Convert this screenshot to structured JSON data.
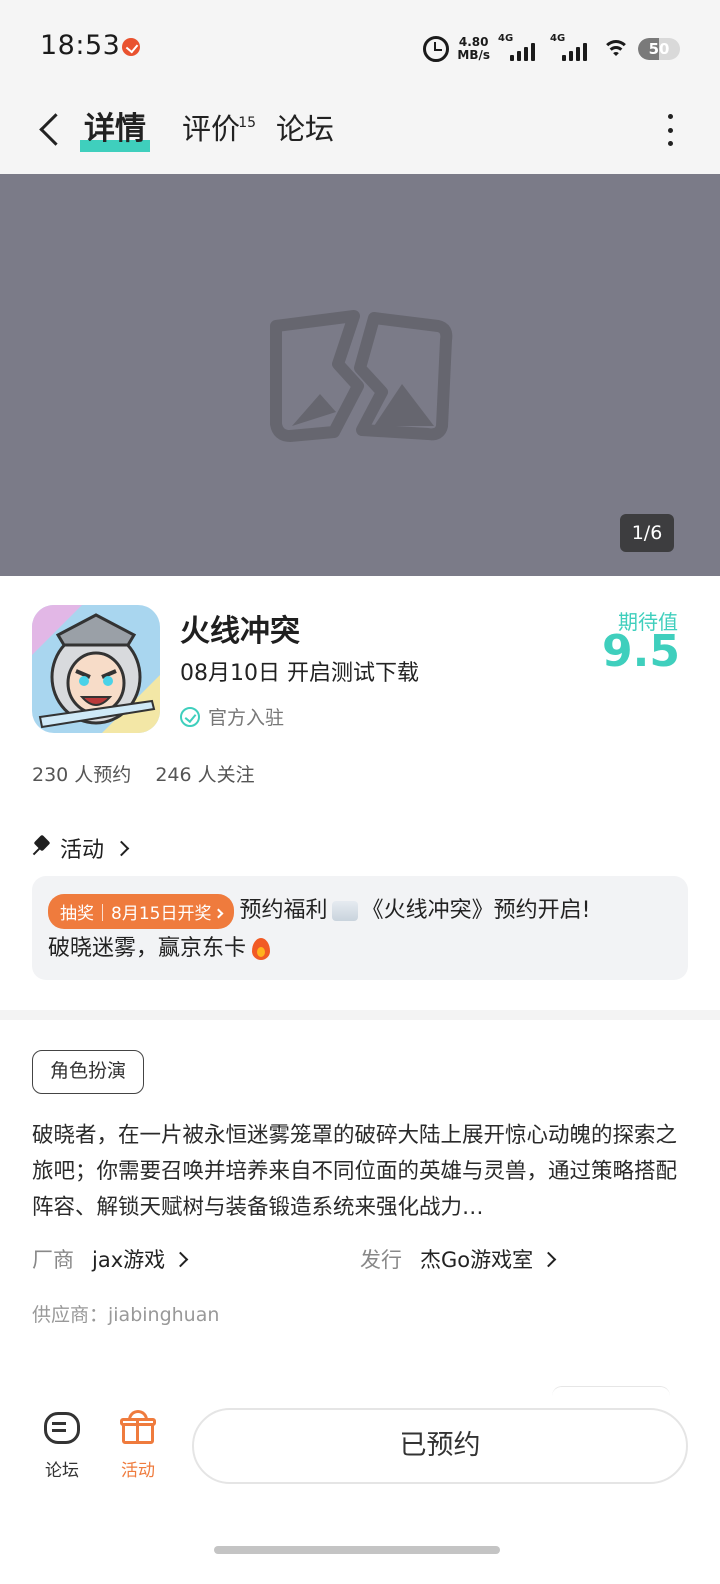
{
  "status_bar": {
    "time": "18:53",
    "net_speed_value": "4.80",
    "net_speed_unit": "MB/s",
    "signal1_label": "4G",
    "signal2_label": "4G",
    "battery": "50",
    "battery_level": 0.5
  },
  "header": {
    "tabs": [
      {
        "label": "详情",
        "active": true
      },
      {
        "label": "评价",
        "badge": "15"
      },
      {
        "label": "论坛"
      }
    ]
  },
  "banner": {
    "page_indicator": "1/6"
  },
  "game": {
    "title": "火线冲突",
    "date_text": "08月10日 开启测试下载",
    "official_label": "官方入驻",
    "expect_label": "期待值",
    "expect_score": "9.5",
    "reservations": "230 人预约",
    "followers": "246 人关注"
  },
  "activity": {
    "heading": "活动",
    "tag": "抽奖｜8月15日开奖",
    "text_part1": "预约福利",
    "text_part2": "《火线冲突》预约开启!",
    "text_part3": "破晓迷雾，赢京东卡"
  },
  "details": {
    "genre": "角色扮演",
    "description": "破晓者，在一片被永恒迷雾笼罩的破碎大陆上展开惊心动魄的探索之旅吧；你需要召唤并培养来自不同位面的英雄与灵兽，通过策略搭配阵容、解锁天赋树与装备锻造系统来强化战力…",
    "vendor_label": "厂商",
    "vendor_value": "jax游戏",
    "publisher_label": "发行",
    "publisher_value": "杰Go游戏室",
    "supplier": "供应商：jiabinghuan"
  },
  "bottom_bar": {
    "forum_label": "论坛",
    "activity_label": "活动",
    "reserve_label": "已预约"
  },
  "colors": {
    "accent_teal": "#3fcfbd",
    "accent_orange": "#ef7b3d",
    "banner_bg": "#7b7b88"
  }
}
